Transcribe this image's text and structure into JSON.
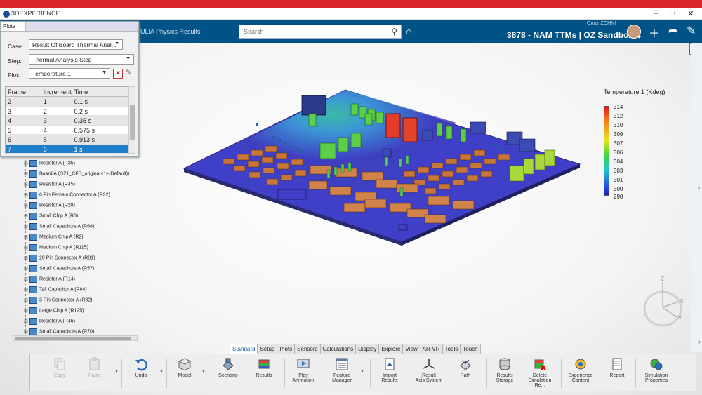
{
  "titlebar": {
    "app_name": "3DEXPERIENCE",
    "min": "–",
    "max": "□",
    "close": "✕"
  },
  "header": {
    "app_title": "ULIA Physics Results",
    "search_placeholder": "Search",
    "user_name": "Omar ZOHNI",
    "context": "3878 - NAM TTMs | OZ Sandbox ⌄"
  },
  "plots_panel": {
    "tab_label": "Plots",
    "case_label": "Case:",
    "case_value": "Result Of Board Thermal Anal...",
    "step_label": "Step:",
    "step_value": "Thermal Analysis Step",
    "plot_label": "Plot:",
    "plot_value": "Temperature.1",
    "columns": [
      "Frame",
      "Increment",
      "Time"
    ],
    "rows": [
      {
        "frame": "2",
        "increment": "1",
        "time": "0.1 s"
      },
      {
        "frame": "3",
        "increment": "2",
        "time": "0.2 s"
      },
      {
        "frame": "4",
        "increment": "3",
        "time": "0.35 s"
      },
      {
        "frame": "5",
        "increment": "4",
        "time": "0.575 s"
      },
      {
        "frame": "6",
        "increment": "5",
        "time": "0.913 s"
      },
      {
        "frame": "7",
        "increment": "6",
        "time": "1 s"
      }
    ]
  },
  "tree": {
    "items": [
      "Resistor A (R35)",
      "Board A (OZ1_CFD_original<1>(Default))",
      "Resistor A (R45)",
      "6 Pin Female Connector A (R92)",
      "Resistor A (R28)",
      "Small Chip A (R3)",
      "Small Capacitors A (R68)",
      "Medium Chip A (R2)",
      "Medium Chip A (R115)",
      "20 Pin Connector A (R81)",
      "Small Capacitors A (R57)",
      "Resistor A (R14)",
      "Tall Capacitor A (R84)",
      "3 Pin Connector A (R82)",
      "Large Chip A (R125)",
      "Resistor A (R46)",
      "Small Capacitors A (R70)"
    ]
  },
  "legend": {
    "title": "Temperature.1 (Kdeg)",
    "ticks": [
      "314",
      "312",
      "310",
      "309",
      "307",
      "306",
      "304",
      "303",
      "301",
      "300",
      "298"
    ]
  },
  "compass": {
    "x": "X",
    "y": "Y",
    "z": "Z"
  },
  "tabs": [
    "Standard",
    "Setup",
    "Plots",
    "Sensors",
    "Calculations",
    "Display",
    "Explore",
    "View",
    "AR-VR",
    "Tools",
    "Touch"
  ],
  "toolbar": {
    "copy": "Copy",
    "paste": "Paste",
    "undo": "Undo",
    "model": "Model",
    "scenario": "Scenario",
    "results": "Results",
    "play_animation": "Play\nAnimation",
    "feature_manager": "Feature\nManager",
    "import_results": "Import\nResults",
    "result_axis_system": "Result\nAxis System",
    "path": "Path",
    "results_storage": "Results\nStorage",
    "delete_simulation": "Delete\nSimulation Re...",
    "experience_content": "Experience\nContent",
    "report": "Report",
    "simulation_properties": "Simulation\nProperties"
  },
  "colors": {
    "brand_red": "#d9262b",
    "header_blue": "#005386",
    "selection_blue": "#1f7ec7",
    "board_blue": "#3f3fc0"
  }
}
